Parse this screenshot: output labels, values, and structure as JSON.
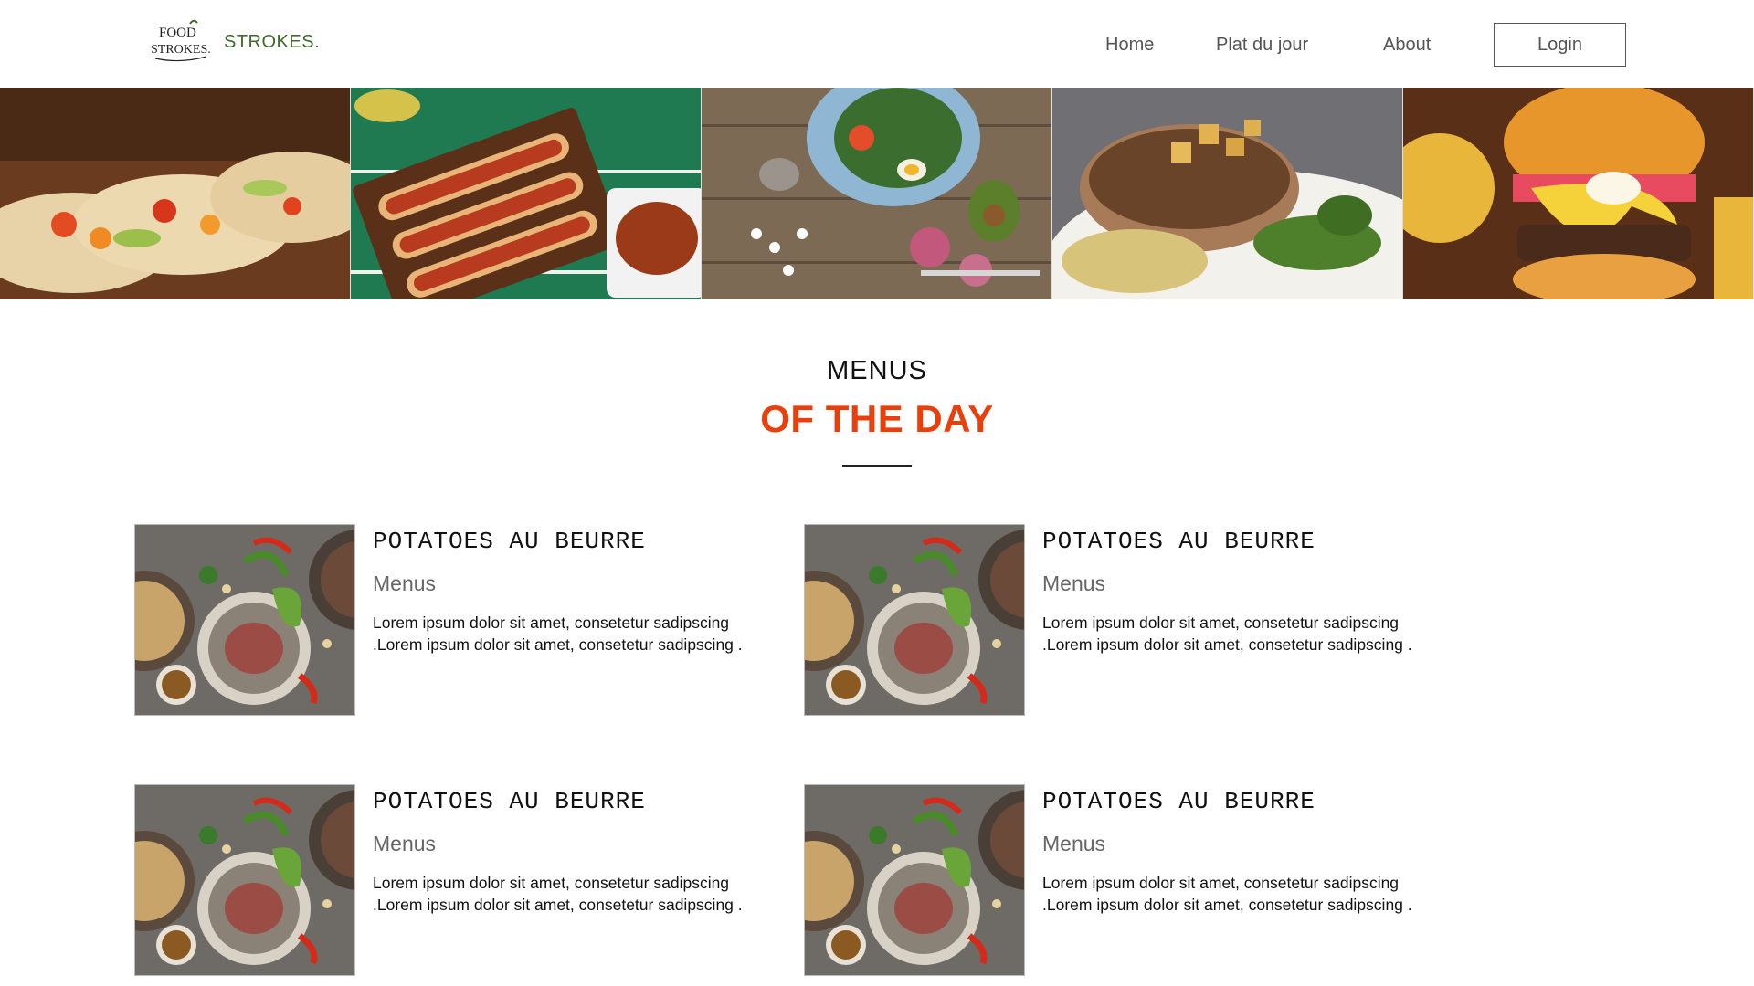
{
  "brand": {
    "logo_text": "FOOD STROKES.",
    "name": "STROKES.",
    "color": "#3f6b2c"
  },
  "nav": {
    "items": [
      {
        "label": "Home"
      },
      {
        "label": "Plat du jour"
      },
      {
        "label": "About"
      }
    ],
    "login_label": "Login"
  },
  "banner": {
    "images": [
      {
        "icon": "tacos-image"
      },
      {
        "icon": "hotdogs-image"
      },
      {
        "icon": "salad-bowl-image"
      },
      {
        "icon": "grilled-meat-image"
      },
      {
        "icon": "burger-image"
      }
    ]
  },
  "section": {
    "heading": "MENUS",
    "subheading": "OF THE DAY",
    "accent": "#e8400c"
  },
  "cards": [
    {
      "title": "POTATOES AU BEURRE",
      "subtitle": "Menus",
      "description": "Lorem ipsum dolor sit amet, consetetur sadipscing .Lorem ipsum dolor sit amet, consetetur sadipscing ."
    },
    {
      "title": "POTATOES AU BEURRE",
      "subtitle": "Menus",
      "description": "Lorem ipsum dolor sit amet, consetetur sadipscing .Lorem ipsum dolor sit amet, consetetur sadipscing ."
    },
    {
      "title": "POTATOES AU BEURRE",
      "subtitle": "Menus",
      "description": "Lorem ipsum dolor sit amet, consetetur sadipscing .Lorem ipsum dolor sit amet, consetetur sadipscing ."
    },
    {
      "title": "POTATOES AU BEURRE",
      "subtitle": "Menus",
      "description": "Lorem ipsum dolor sit amet, consetetur sadipscing .Lorem ipsum dolor sit amet, consetetur sadipscing ."
    }
  ]
}
